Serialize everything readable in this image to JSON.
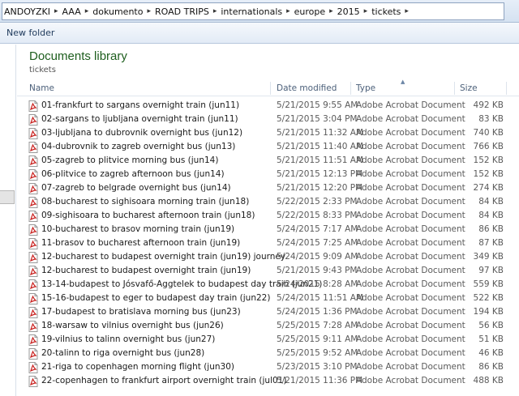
{
  "breadcrumb": [
    "ANDOYZKI",
    "AAA",
    "dokumento",
    "ROAD TRIPS",
    "internationals",
    "europe",
    "2015",
    "tickets"
  ],
  "toolbar": {
    "new_folder_label": "New folder"
  },
  "library": {
    "title": "Documents library",
    "subtitle": "tickets"
  },
  "columns": {
    "name": "Name",
    "date": "Date modified",
    "type": "Type",
    "size": "Size"
  },
  "icons": {
    "file": "pdf-file-icon",
    "separator": "chevron-right-icon",
    "sort": "sort-up-arrow-icon"
  },
  "colors": {
    "library_title": "#1e5e1e",
    "pdf_icon": "#c8201e"
  },
  "files": [
    {
      "name": "01-frankfurt to sargans overnight train (jun11)",
      "date": "5/21/2015 9:55 AM",
      "type": "Adobe Acrobat Document",
      "size": "492 KB"
    },
    {
      "name": "02-sargans to ljubljana overnight train (jun11)",
      "date": "5/21/2015 3:04 PM",
      "type": "Adobe Acrobat Document",
      "size": "83 KB"
    },
    {
      "name": "03-ljubljana to dubrovnik overnight bus (jun12)",
      "date": "5/21/2015 11:32 AM",
      "type": "Adobe Acrobat Document",
      "size": "740 KB"
    },
    {
      "name": "04-dubrovnik to zagreb overnight bus (jun13)",
      "date": "5/21/2015 11:40 AM",
      "type": "Adobe Acrobat Document",
      "size": "766 KB"
    },
    {
      "name": "05-zagreb to plitvice morning bus (jun14)",
      "date": "5/21/2015 11:51 AM",
      "type": "Adobe Acrobat Document",
      "size": "152 KB"
    },
    {
      "name": "06-plitvice to zagreb afternoon bus (jun14)",
      "date": "5/21/2015 12:13 PM",
      "type": "Adobe Acrobat Document",
      "size": "152 KB"
    },
    {
      "name": "07-zagreb to belgrade overnight bus (jun14)",
      "date": "5/21/2015 12:20 PM",
      "type": "Adobe Acrobat Document",
      "size": "274 KB"
    },
    {
      "name": "08-bucharest to sighisoara morning train (jun18)",
      "date": "5/22/2015 2:33 PM",
      "type": "Adobe Acrobat Document",
      "size": "84 KB"
    },
    {
      "name": "09-sighisoara to bucharest afternoon train (jun18)",
      "date": "5/22/2015 8:33 PM",
      "type": "Adobe Acrobat Document",
      "size": "84 KB"
    },
    {
      "name": "10-bucharest to brasov morning train (jun19)",
      "date": "5/24/2015 7:17 AM",
      "type": "Adobe Acrobat Document",
      "size": "86 KB"
    },
    {
      "name": "11-brasov to bucharest afternoon train (jun19)",
      "date": "5/24/2015 7:25 AM",
      "type": "Adobe Acrobat Document",
      "size": "87 KB"
    },
    {
      "name": "12-bucharest to budapest overnight train (jun19) journey",
      "date": "5/24/2015 9:09 AM",
      "type": "Adobe Acrobat Document",
      "size": "349 KB"
    },
    {
      "name": "12-bucharest to budapest overnight train (jun19)",
      "date": "5/21/2015 9:43 PM",
      "type": "Adobe Acrobat Document",
      "size": "97 KB"
    },
    {
      "name": "13-14-budapest to Jósvafő-Aggtelek to budapest day train (jun21)",
      "date": "5/24/2015 8:28 AM",
      "type": "Adobe Acrobat Document",
      "size": "559 KB"
    },
    {
      "name": "15-16-budapest to eger to budapest day train (jun22)",
      "date": "5/24/2015 11:51 AM",
      "type": "Adobe Acrobat Document",
      "size": "522 KB"
    },
    {
      "name": "17-budapest to bratislava morning bus (jun23)",
      "date": "5/24/2015 1:36 PM",
      "type": "Adobe Acrobat Document",
      "size": "194 KB"
    },
    {
      "name": "18-warsaw to vilnius overnight bus (jun26)",
      "date": "5/25/2015 7:28 AM",
      "type": "Adobe Acrobat Document",
      "size": "56 KB"
    },
    {
      "name": "19-vilnius to talinn overnight bus (jun27)",
      "date": "5/25/2015 9:11 AM",
      "type": "Adobe Acrobat Document",
      "size": "51 KB"
    },
    {
      "name": "20-talinn to riga overnight bus (jun28)",
      "date": "5/25/2015 9:52 AM",
      "type": "Adobe Acrobat Document",
      "size": "46 KB"
    },
    {
      "name": "21-riga to copenhagen morning flight (jun30)",
      "date": "5/23/2015 3:10 PM",
      "type": "Adobe Acrobat Document",
      "size": "86 KB"
    },
    {
      "name": "22-copenhagen to frankfurt airport overnight train (jul01)",
      "date": "5/21/2015 11:36 PM",
      "type": "Adobe Acrobat Document",
      "size": "488 KB"
    }
  ]
}
